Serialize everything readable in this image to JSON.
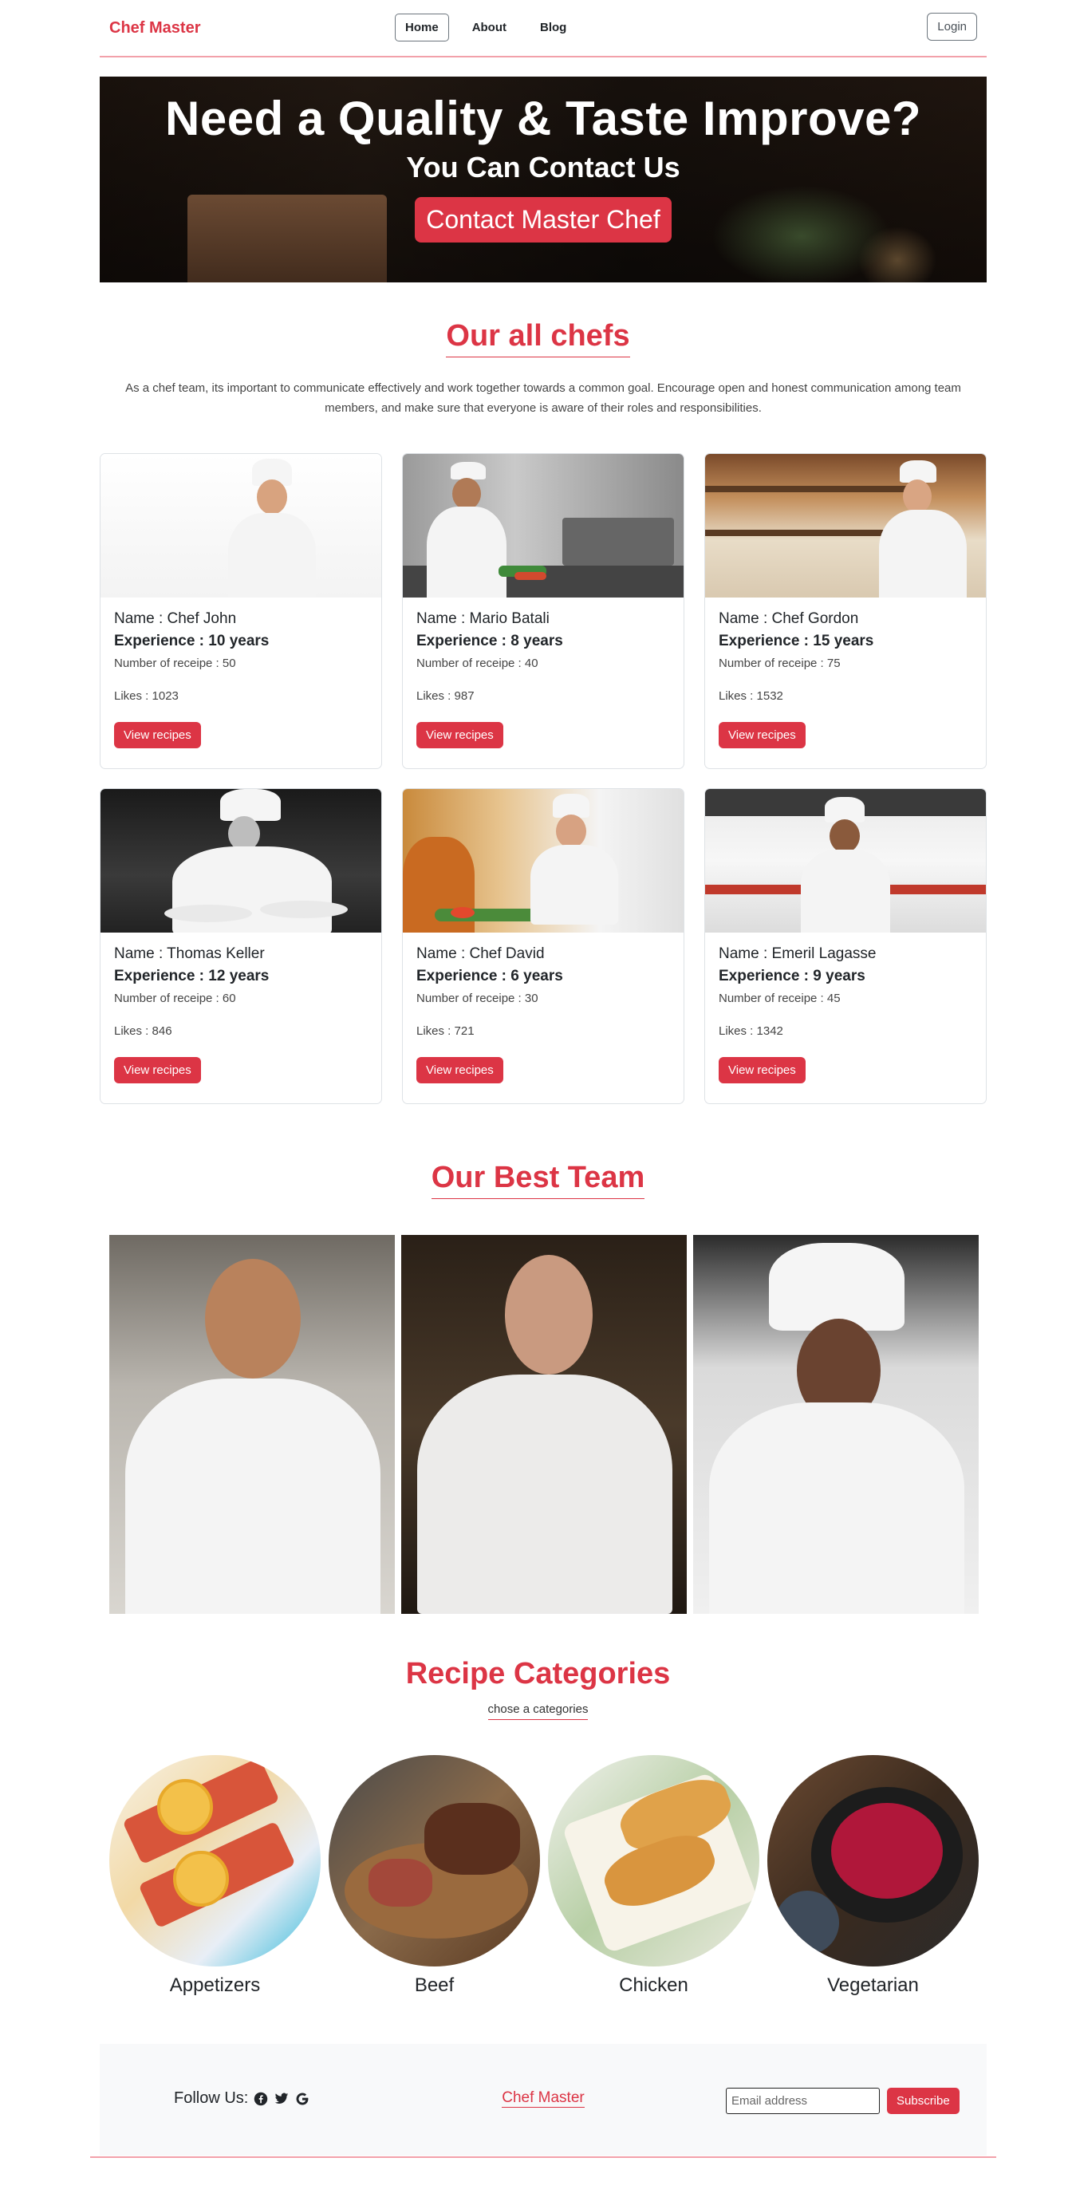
{
  "navbar": {
    "brand": "Chef Master",
    "links": [
      {
        "label": "Home",
        "active": true
      },
      {
        "label": "About",
        "active": false
      },
      {
        "label": "Blog",
        "active": false
      }
    ],
    "login_label": "Login"
  },
  "hero": {
    "title": "Need a Quality & Taste Improve?",
    "subtitle": "You Can Contact Us",
    "button_label": "Contact Master Chef"
  },
  "chefs_section": {
    "title": "Our all chefs",
    "description": "As a chef team, its important to communicate effectively and work together towards a common goal. Encourage open and honest communication among team members, and make sure that everyone is aware of their roles and responsibilities."
  },
  "chefs": [
    {
      "name": "Name : Chef John",
      "experience": "Experience : 10 years",
      "recipes": "Number of receipe : 50",
      "likes": "Likes : 1023",
      "button": "View recipes"
    },
    {
      "name": "Name : Mario Batali",
      "experience": "Experience : 8 years",
      "recipes": "Number of receipe : 40",
      "likes": "Likes : 987",
      "button": "View recipes"
    },
    {
      "name": "Name : Chef Gordon",
      "experience": "Experience : 15 years",
      "recipes": "Number of receipe : 75",
      "likes": "Likes : 1532",
      "button": "View recipes"
    },
    {
      "name": "Name : Thomas Keller",
      "experience": "Experience : 12 years",
      "recipes": "Number of receipe : 60",
      "likes": "Likes : 846",
      "button": "View recipes"
    },
    {
      "name": "Name : Chef David",
      "experience": "Experience : 6 years",
      "recipes": "Number of receipe : 30",
      "likes": "Likes : 721",
      "button": "View recipes"
    },
    {
      "name": "Name : Emeril Lagasse",
      "experience": "Experience : 9 years",
      "recipes": "Number of receipe : 45",
      "likes": "Likes : 1342",
      "button": "View recipes"
    }
  ],
  "team_section": {
    "title": "Our Best Team"
  },
  "categories_section": {
    "title": "Recipe Categories",
    "subtitle": "chose a categories",
    "items": [
      {
        "label": "Appetizers"
      },
      {
        "label": "Beef"
      },
      {
        "label": "Chicken"
      },
      {
        "label": "Vegetarian"
      }
    ]
  },
  "footer": {
    "follow_label": "Follow Us:",
    "social_icons": [
      "facebook-icon",
      "twitter-icon",
      "google-icon"
    ],
    "brand": "Chef Master",
    "email_placeholder": "Email address",
    "subscribe_label": "Subscribe"
  },
  "colors": {
    "accent": "#dc3545",
    "accent_light": "#f2a1aa",
    "footer_bg": "#f8f9fa"
  }
}
